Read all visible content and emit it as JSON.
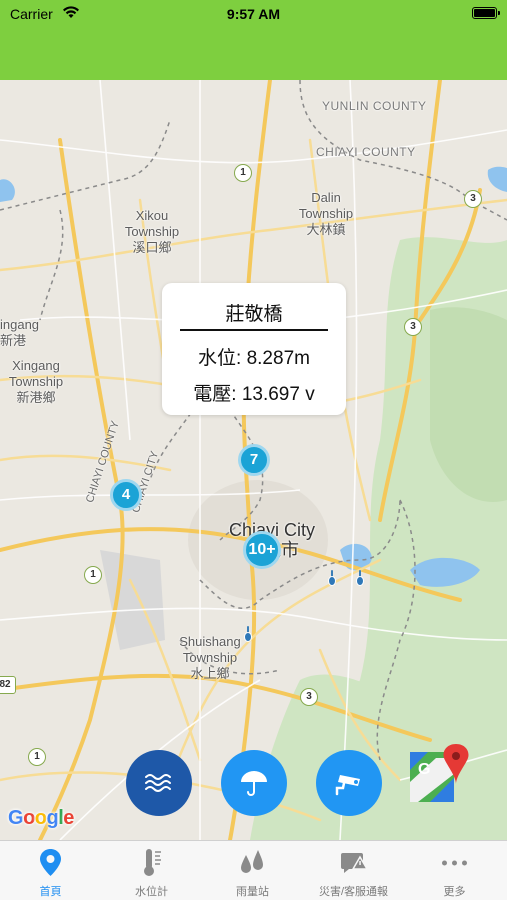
{
  "status_bar": {
    "carrier": "Carrier",
    "time": "9:57 AM"
  },
  "header": {
    "color": "#7ecf3f"
  },
  "map": {
    "labels": {
      "yunlin": "YUNLIN COUNTY",
      "chiayi_county": "CHIAYI COUNTY",
      "dalin_en": "Dalin",
      "dalin_en2": "Township",
      "dalin_zh": "大林鎮",
      "xikou_en": "Xikou",
      "xikou_en2": "Township",
      "xikou_zh": "溪口鄉",
      "xingang_a": "ingang",
      "xingang_b": "新港",
      "xingang_en": "Xingang",
      "xingang_en2": "Township",
      "xingang_zh": "新港鄉",
      "chiayi_city_en": "Chiayi City",
      "chiayi_city_zh": "嘉義市",
      "shuishang_en": "Shuishang",
      "shuishang_en2": "Township",
      "shuishang_zh": "水上鄉",
      "chiayi_road_1": "CHIAYI COUNTY",
      "chiayi_road_2": "CHIAYI CITY"
    },
    "road_shields": [
      "1",
      "1",
      "3",
      "3",
      "3",
      "1",
      "82"
    ],
    "clusters": {
      "c7": "7",
      "c4": "4",
      "c10": "10+"
    },
    "attribution": "Google"
  },
  "popup": {
    "title": "莊敬橋",
    "water_level": "水位: 8.287m",
    "voltage": "電壓: 13.697 v"
  },
  "fabs": {
    "water": "wave-icon",
    "rain": "umbrella-icon",
    "camera": "cctv-camera-icon"
  },
  "tabs": [
    {
      "label": "首頁",
      "icon": "location-pin-icon"
    },
    {
      "label": "水位計",
      "icon": "thermometer-icon"
    },
    {
      "label": "雨量站",
      "icon": "rain-drops-icon"
    },
    {
      "label": "災害/客服通報",
      "icon": "chat-alert-icon"
    },
    {
      "label": "更多",
      "icon": "more-icon"
    }
  ],
  "colors": {
    "accent": "#1f8ef1",
    "cluster": "#1ba3d6",
    "fab_dark": "#1e58a8",
    "fab_light": "#2196f3"
  }
}
